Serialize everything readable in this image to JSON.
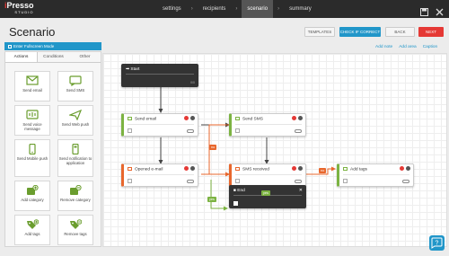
{
  "app": {
    "logo_main": "Presso",
    "logo_prefix": "i",
    "logo_sub": "STUDIO"
  },
  "nav": {
    "items": [
      "settings",
      "recipients",
      "scenario",
      "summary"
    ],
    "active": "scenario",
    "separator": "›"
  },
  "header": {
    "title": "Scenario",
    "templates": "TEMPLATES",
    "check": "CHECK IF CORRECT",
    "back": "BACK",
    "next": "NEXT"
  },
  "panel": {
    "fullscreen": "Enter Fullscreen Mode",
    "tabs": [
      "Actions",
      "Conditions",
      "Other"
    ],
    "tiles": [
      {
        "label": "Send email",
        "icon": "send-email-icon"
      },
      {
        "label": "Send SMS",
        "icon": "send-sms-icon"
      },
      {
        "label": "Send voice message",
        "icon": "voice-message-icon"
      },
      {
        "label": "Send Web push",
        "icon": "web-push-icon"
      },
      {
        "label": "Send Mobile push",
        "icon": "mobile-push-icon"
      },
      {
        "label": "Send notification to application",
        "icon": "app-notification-icon"
      },
      {
        "label": "Add category",
        "icon": "add-category-icon"
      },
      {
        "label": "Remove category",
        "icon": "remove-category-icon"
      },
      {
        "label": "Add tags",
        "icon": "add-tags-icon"
      },
      {
        "label": "Remove tags",
        "icon": "remove-tags-icon"
      }
    ]
  },
  "canvas": {
    "links": [
      "Add note",
      "Add area",
      "Caption"
    ],
    "start": {
      "title": "Start",
      "sub": "0/0"
    },
    "nodes": {
      "send_email": "Send email",
      "send_sms": "Send SMS",
      "opened_email": "Opened e-mail",
      "sms_received": "SMS received",
      "add_tags": "Add tags"
    },
    "end": {
      "title": "End"
    },
    "tags": {
      "no": "no",
      "yes": "yes"
    }
  },
  "colors": {
    "accent": "#2196c9",
    "danger": "#e53935",
    "action": "#7cb342",
    "condition": "#e8672d",
    "topbar": "#2b2b2b"
  }
}
